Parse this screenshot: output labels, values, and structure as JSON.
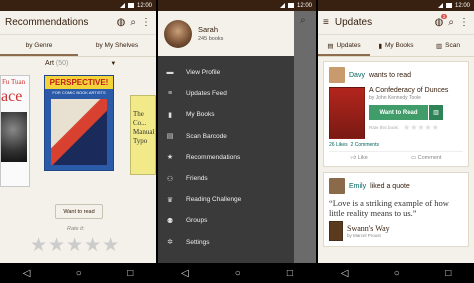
{
  "status": {
    "time": "12:00"
  },
  "screen1": {
    "title": "Recommendations",
    "tabs": [
      "by Genre",
      "by My Shelves"
    ],
    "genre": "Art",
    "genre_count": "(50)",
    "partial_author": "Fu Tuan",
    "partial_word": "ace",
    "cover2_title": "PERSPECTIVE!",
    "cover2_subtitle": "FOR COMIC BOOK ARTISTS",
    "cover3_text": "The Co... Manual Typo",
    "want_to_read": "Want to read",
    "rate_it": "Rate it:",
    "stars": "★★★★★"
  },
  "screen2": {
    "user_name": "Sarah",
    "books_count": "245 books",
    "menu": [
      {
        "icon": "person-icon",
        "glyph": "▬",
        "label": "View Profile"
      },
      {
        "icon": "feed-icon",
        "glyph": "≡",
        "label": "Updates Feed"
      },
      {
        "icon": "books-icon",
        "glyph": "▮",
        "label": "My Books"
      },
      {
        "icon": "barcode-icon",
        "glyph": "▤",
        "label": "Scan Barcode"
      },
      {
        "icon": "star-icon",
        "glyph": "★",
        "label": "Recommendations"
      },
      {
        "icon": "friends-icon",
        "glyph": "⚇",
        "label": "Friends"
      },
      {
        "icon": "trophy-icon",
        "glyph": "♛",
        "label": "Reading Challenge"
      },
      {
        "icon": "groups-icon",
        "glyph": "⚉",
        "label": "Groups"
      },
      {
        "icon": "gear-icon",
        "glyph": "✲",
        "label": "Settings"
      }
    ]
  },
  "screen3": {
    "title": "Updates",
    "notif_count": "2",
    "tabs": [
      "Updates",
      "My Books",
      "Scan"
    ],
    "card1": {
      "user": "Davy",
      "action": "wants to read",
      "book_title": "A Confederacy of Dunces",
      "author": "by John Kennedy Toole",
      "want_to_read": "Want to Read",
      "rate_label": "Rate this book:",
      "likes": "26 Likes",
      "comments": "2 Comments",
      "like": "Like",
      "comment": "Comment"
    },
    "card2": {
      "user": "Emily",
      "action": "liked a quote",
      "quote": "“Love is a striking example of how little reality means to us.”",
      "book_title": "Swann's Way",
      "author": "by Marcel Proust"
    }
  },
  "colors": {
    "brand": "#382110",
    "green": "#409d69",
    "link": "#00635d"
  }
}
